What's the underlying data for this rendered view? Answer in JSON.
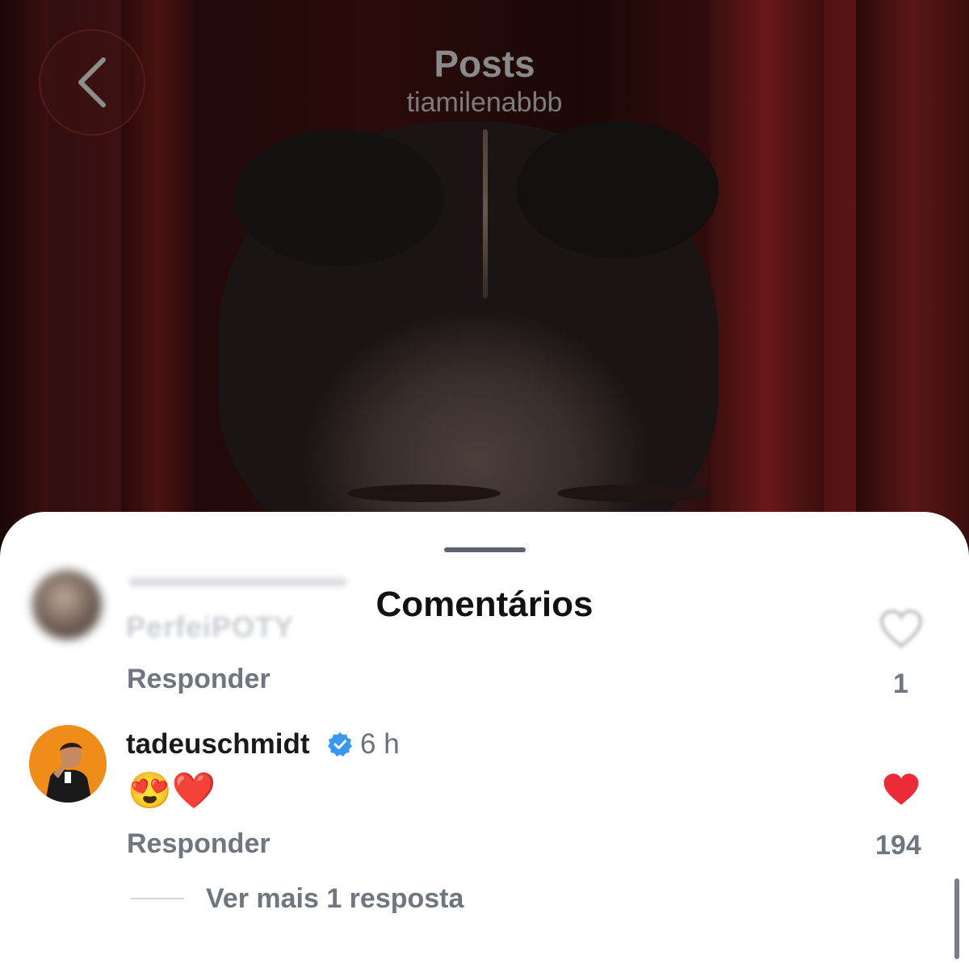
{
  "header": {
    "title": "Posts",
    "handle": "tiamilenabbb"
  },
  "sheet": {
    "title": "Comentários",
    "blurred_comment": {
      "text": "PerfeiPOTY",
      "reply_label": "Responder",
      "like_count": "1"
    },
    "comment": {
      "username": "tadeuschmidt",
      "time": "6 h",
      "body": "😍❤️",
      "reply_label": "Responder",
      "like_count": "194",
      "liked": true,
      "heart_color": "#ed2a3a"
    },
    "view_more": "Ver mais 1 resposta"
  },
  "colors": {
    "verified_badge": "#3897f0",
    "avatar_bg": "#f08c1a"
  }
}
